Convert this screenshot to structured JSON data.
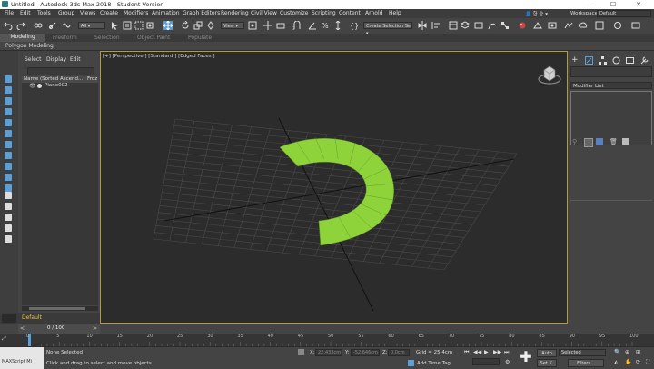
{
  "window": {
    "title": "Untitled - Autodesk 3ds Max 2018 - Student Version",
    "minimize": "—",
    "maximize": "☐",
    "close": "✕"
  },
  "menu": [
    "File",
    "Edit",
    "Tools",
    "Group",
    "Views",
    "Create",
    "Modifiers",
    "Animation",
    "Graph Editors",
    "Rendering",
    "Civil View",
    "Customize",
    "Scripting",
    "Content",
    "Arnold",
    "Help"
  ],
  "menu_right": {
    "user_label": "한 승",
    "workspaces_label": "Workspaces:",
    "workspace_value": "Default"
  },
  "toolbar": {
    "filter_value": "All",
    "coord_value": "View",
    "selection_set_placeholder": "Create Selection Se"
  },
  "ribbon": {
    "tabs": [
      "Modeling",
      "Freeform",
      "Selection",
      "Object Paint",
      "Populate"
    ],
    "subtitle": "Polygon Modeling"
  },
  "explorer": {
    "tabs": [
      "Select",
      "Display",
      "Edit"
    ],
    "column_name": "Name (Sorted Ascend...",
    "column_frozen": "Froz",
    "items": [
      {
        "name": "Plane002"
      }
    ]
  },
  "viewport": {
    "label": "[+] [Perspective ] [Standard ] [Edged Faces ]"
  },
  "cmdpanel": {
    "modifier_list": "Modifier List"
  },
  "layer": {
    "name": "Default"
  },
  "timeslider": {
    "value": "0 / 100"
  },
  "trackbar": {
    "ticks": [
      "0",
      "5",
      "10",
      "15",
      "20",
      "25",
      "30",
      "35",
      "40",
      "45",
      "50",
      "55",
      "60",
      "65",
      "70",
      "75",
      "80",
      "85",
      "90",
      "95",
      "100"
    ]
  },
  "status": {
    "maxscript": "MAXScript Mi",
    "none_selected": "None Selected",
    "prompt": "Click and drag to select and move objects",
    "x_label": "X:",
    "x_value": "22.433cm",
    "y_label": "Y:",
    "y_value": "-52.646cm",
    "z_label": "Z:",
    "z_value": "0.0cm",
    "grid": "Grid = 25.4cm",
    "add_time_tag": "Add Time Tag",
    "auto": "Auto",
    "set_key": "Set K.",
    "selected": "Selected",
    "filters": "Filters..."
  },
  "colors": {
    "accent": "#5b9fd6",
    "object_green": "#8ed33a",
    "viewport_border": "#b49b3b"
  }
}
